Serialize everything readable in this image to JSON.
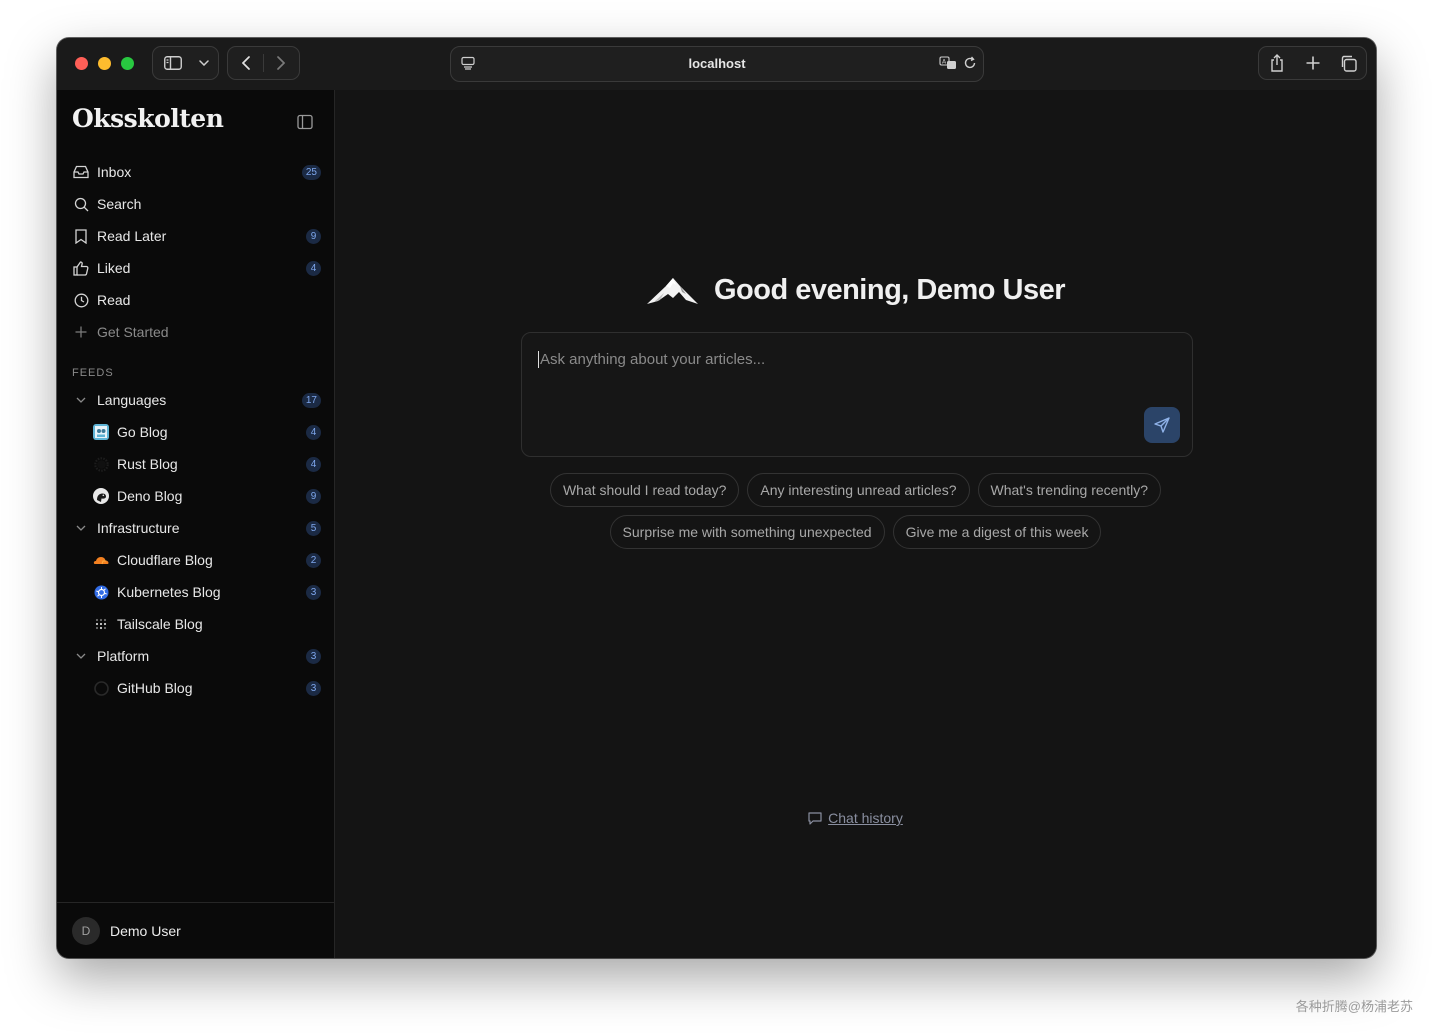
{
  "browser": {
    "url": "localhost"
  },
  "sidebar": {
    "brand": "Oksskolten",
    "nav": [
      {
        "label": "Inbox",
        "icon": "inbox-icon",
        "count": "25"
      },
      {
        "label": "Search",
        "icon": "search-icon",
        "count": ""
      },
      {
        "label": "Read Later",
        "icon": "bookmark-icon",
        "count": "9"
      },
      {
        "label": "Liked",
        "icon": "thumbs-up-icon",
        "count": "4"
      },
      {
        "label": "Read",
        "icon": "clock-icon",
        "count": ""
      },
      {
        "label": "Get Started",
        "icon": "plus-icon",
        "count": ""
      }
    ],
    "feeds_label": "FEEDS",
    "folders": [
      {
        "label": "Languages",
        "count": "17",
        "feeds": [
          {
            "label": "Go Blog",
            "count": "4"
          },
          {
            "label": "Rust Blog",
            "count": "4"
          },
          {
            "label": "Deno Blog",
            "count": "9"
          }
        ]
      },
      {
        "label": "Infrastructure",
        "count": "5",
        "feeds": [
          {
            "label": "Cloudflare Blog",
            "count": "2"
          },
          {
            "label": "Kubernetes Blog",
            "count": "3"
          },
          {
            "label": "Tailscale Blog",
            "count": ""
          }
        ]
      },
      {
        "label": "Platform",
        "count": "3",
        "feeds": [
          {
            "label": "GitHub Blog",
            "count": "3"
          }
        ]
      }
    ],
    "user": {
      "initial": "D",
      "name": "Demo User"
    }
  },
  "main": {
    "greeting": "Good evening, Demo User",
    "placeholder": "Ask anything about your articles...",
    "suggestions_row1": [
      "What should I read today?",
      "Any interesting unread articles?",
      "What's trending recently?"
    ],
    "suggestions_row2": [
      "Surprise me with something unexpected",
      "Give me a digest of this week"
    ],
    "history_label": "Chat history"
  },
  "watermark": "各种折腾@杨浦老苏",
  "colors": {
    "background": "#141414",
    "sidebar": "#0a0a0a",
    "badge_bg": "#1b2a44",
    "badge_text": "#7fa8ee",
    "send_button": "#2b4468"
  }
}
